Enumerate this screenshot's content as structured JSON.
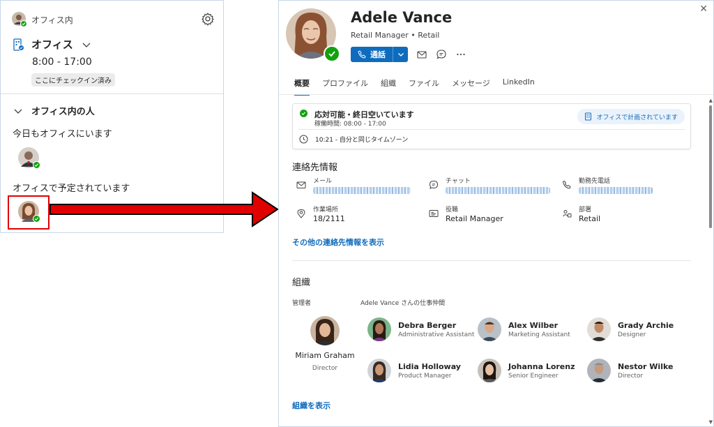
{
  "left_panel": {
    "title": "オフィス内",
    "office": {
      "name": "オフィス",
      "hours": "8:00 - 17:00",
      "badge": "ここにチェックイン済み"
    },
    "people": {
      "section_title": "オフィス内の人",
      "today_label": "今日もオフィスにいます",
      "planned_label": "オフィスで予定されています"
    }
  },
  "profile": {
    "name": "Adele Vance",
    "job": "Retail Manager • Retail",
    "call_label": "通話",
    "tabs": [
      "概要",
      "プロファイル",
      "組織",
      "ファイル",
      "メッセージ",
      "LinkedIn"
    ],
    "availability": {
      "status": "応対可能・終日空いています",
      "hours": "稼働時間: 08:00 - 17:00",
      "office_pill": "オフィスで計画されています",
      "timezone": "10:21 - 自分と同じタイムゾーン"
    },
    "contact": {
      "title": "連絡先情報",
      "email_label": "メール",
      "chat_label": "チャット",
      "phone_label": "勤務先電話",
      "location_label": "作業場所",
      "location_value": "18/2111",
      "role_label": "役職",
      "role_value": "Retail Manager",
      "dept_label": "部署",
      "dept_value": "Retail",
      "more_link": "その他の連絡先情報を表示"
    },
    "org": {
      "title": "組織",
      "manager_label": "管理者",
      "peers_label": "Adele Vance さんの仕事仲間",
      "manager": {
        "name": "Miriam Graham",
        "title": "Director"
      },
      "peers": [
        {
          "name": "Debra Berger",
          "title": "Administrative Assistant"
        },
        {
          "name": "Alex Wilber",
          "title": "Marketing Assistant"
        },
        {
          "name": "Grady Archie",
          "title": "Designer"
        },
        {
          "name": "Lidia Holloway",
          "title": "Product Manager"
        },
        {
          "name": "Johanna Lorenz",
          "title": "Senior Engineer"
        },
        {
          "name": "Nestor Wilke",
          "title": "Director"
        }
      ],
      "view_link": "組織を表示"
    }
  },
  "colors": {
    "accent": "#0f6cbd",
    "available": "#13a10e",
    "highlight": "#e00000"
  }
}
